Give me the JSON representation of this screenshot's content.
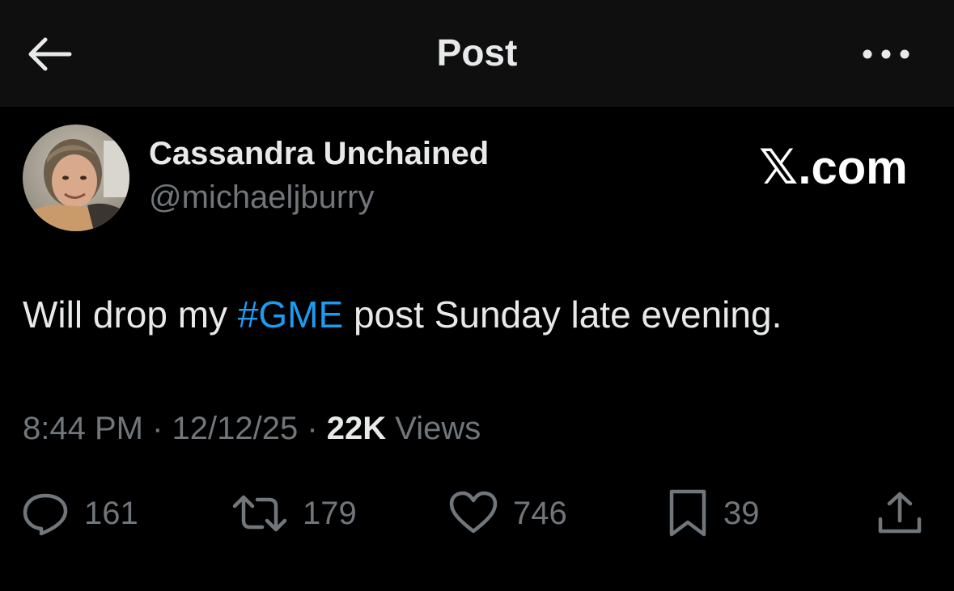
{
  "header": {
    "title": "Post",
    "back_icon": "arrow-left-icon",
    "more_icon": "more-horizontal-icon"
  },
  "author": {
    "display_name": "Cassandra Unchained",
    "handle": "@michaeljburry"
  },
  "watermark": {
    "logo_letter": "𝕏",
    "text": ".com"
  },
  "post": {
    "text_before": "Will drop my ",
    "hashtag": "#GME",
    "text_after": " post Sunday late evening."
  },
  "meta": {
    "time": "8:44 PM",
    "separator": " · ",
    "date": "12/12/25",
    "views_count": "22K",
    "views_label": " Views"
  },
  "actions": {
    "reply": {
      "icon": "reply-icon",
      "count": "161"
    },
    "repost": {
      "icon": "repost-icon",
      "count": "179"
    },
    "like": {
      "icon": "heart-icon",
      "count": "746"
    },
    "bookmark": {
      "icon": "bookmark-icon",
      "count": "39"
    },
    "share": {
      "icon": "share-icon"
    }
  },
  "colors": {
    "background": "#000000",
    "header_background": "#0f0f0f",
    "primary_text": "#e7e9ea",
    "secondary_text": "#71767b",
    "hashtag": "#1d9bf0"
  }
}
